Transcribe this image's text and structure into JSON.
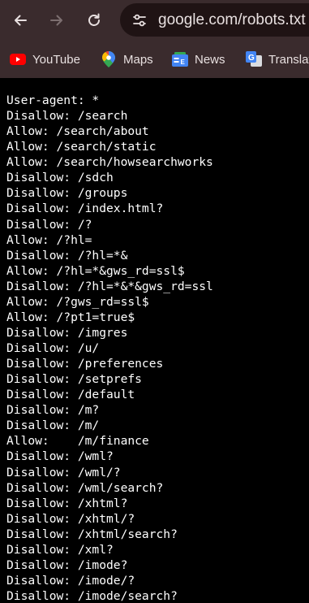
{
  "toolbar": {
    "back_icon": "arrow-left-icon",
    "forward_icon": "arrow-right-icon",
    "reload_icon": "reload-icon",
    "site_info_icon": "tune-icon",
    "url": "google.com/robots.txt"
  },
  "bookmarks": [
    {
      "label": "YouTube",
      "icon": "youtube-icon"
    },
    {
      "label": "Maps",
      "icon": "maps-pin-icon"
    },
    {
      "label": "News",
      "icon": "google-news-icon"
    },
    {
      "label": "Translate",
      "icon": "google-translate-icon"
    }
  ],
  "colors": {
    "toolbar_bg": "#3a2b2d",
    "omnibox_bg": "#1f1314",
    "page_bg": "#000000",
    "text": "#ffffff"
  },
  "robots_lines": [
    "User-agent: *",
    "Disallow: /search",
    "Allow: /search/about",
    "Allow: /search/static",
    "Allow: /search/howsearchworks",
    "Disallow: /sdch",
    "Disallow: /groups",
    "Disallow: /index.html?",
    "Disallow: /?",
    "Allow: /?hl=",
    "Disallow: /?hl=*&",
    "Allow: /?hl=*&gws_rd=ssl$",
    "Disallow: /?hl=*&*&gws_rd=ssl",
    "Allow: /?gws_rd=ssl$",
    "Allow: /?pt1=true$",
    "Disallow: /imgres",
    "Disallow: /u/",
    "Disallow: /preferences",
    "Disallow: /setprefs",
    "Disallow: /default",
    "Disallow: /m?",
    "Disallow: /m/",
    "Allow:    /m/finance",
    "Disallow: /wml?",
    "Disallow: /wml/?",
    "Disallow: /wml/search?",
    "Disallow: /xhtml?",
    "Disallow: /xhtml/?",
    "Disallow: /xhtml/search?",
    "Disallow: /xml?",
    "Disallow: /imode?",
    "Disallow: /imode/?",
    "Disallow: /imode/search?"
  ]
}
